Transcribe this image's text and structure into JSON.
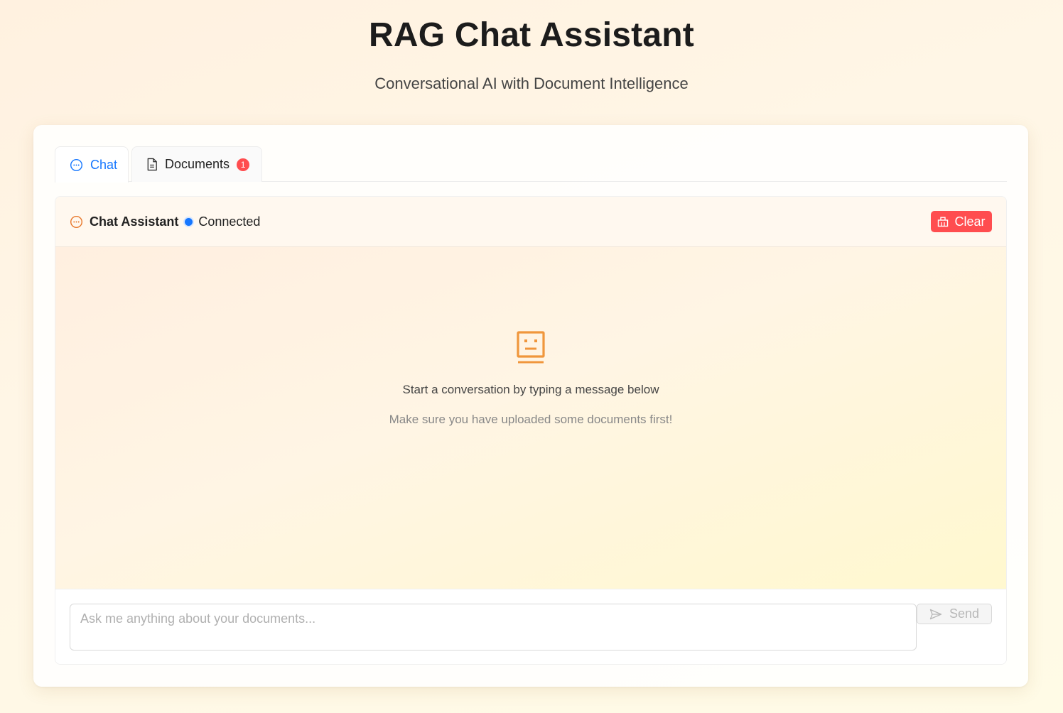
{
  "header": {
    "title": "RAG Chat Assistant",
    "subtitle": "Conversational AI with Document Intelligence"
  },
  "tabs": [
    {
      "label": "Chat",
      "icon": "chat-bubble-icon",
      "active": true
    },
    {
      "label": "Documents",
      "icon": "file-icon",
      "badge": "1",
      "active": false
    }
  ],
  "panel": {
    "title": "Chat Assistant",
    "status": "Connected",
    "status_color": "#1677ff",
    "clear_label": "Clear",
    "clear_color": "#ff4d4f"
  },
  "empty_state": {
    "icon": "robot-icon",
    "message": "Start a conversation by typing a message below",
    "hint": "Make sure you have uploaded some documents first!"
  },
  "composer": {
    "placeholder": "Ask me anything about your documents...",
    "value": "",
    "send_label": "Send"
  },
  "colors": {
    "accent": "#1677ff",
    "brand_orange": "#f0963c",
    "danger": "#ff4d4f"
  }
}
